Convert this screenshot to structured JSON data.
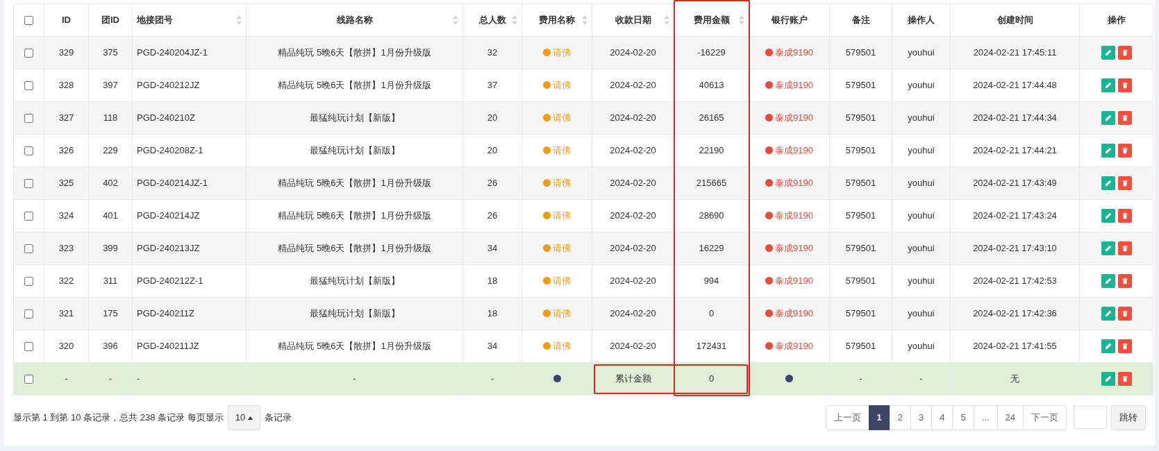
{
  "table": {
    "columns": [
      {
        "kind": "checkbox",
        "checked": false,
        "sortable": false,
        "outlined": false
      },
      {
        "label": "ID",
        "sortable": false,
        "outlined": false
      },
      {
        "label": "团ID",
        "sortable": false,
        "outlined": false
      },
      {
        "label": "地接团号",
        "sortable": true,
        "outlined": false
      },
      {
        "label": "线路名称",
        "sortable": true,
        "outlined": false
      },
      {
        "label": "总人数",
        "sortable": true,
        "outlined": false
      },
      {
        "label": "费用名称",
        "sortable": true,
        "outlined": false
      },
      {
        "label": "收款日期",
        "sortable": true,
        "outlined": false
      },
      {
        "label": "费用金额",
        "sortable": true,
        "outlined": true
      },
      {
        "label": "银行账户",
        "sortable": false,
        "outlined": false
      },
      {
        "label": "备注",
        "sortable": false,
        "outlined": false
      },
      {
        "label": "操作人",
        "sortable": false,
        "outlined": false
      },
      {
        "label": "创建时间",
        "sortable": false,
        "outlined": false
      },
      {
        "label": "操作",
        "sortable": false,
        "outlined": false
      }
    ],
    "rows": [
      {
        "checked": false,
        "id": "329",
        "group_id": "375",
        "code": "PGD-240204JZ-1",
        "route": "精品纯玩 5晚6天【散拼】1月份升级版",
        "people": "32",
        "fee": {
          "text": "请佛",
          "color": "#f39c12"
        },
        "date": "2024-02-20",
        "amount": "-16229",
        "bank": {
          "text": "泰成9190",
          "color": "#e74c3c"
        },
        "note": "579501",
        "operator": "youhui",
        "created": "2024-02-21 17:45:11"
      },
      {
        "checked": false,
        "id": "328",
        "group_id": "397",
        "code": "PGD-240212JZ",
        "route": "精品纯玩 5晚6天【散拼】1月份升级版",
        "people": "37",
        "fee": {
          "text": "请佛",
          "color": "#f39c12"
        },
        "date": "2024-02-20",
        "amount": "40613",
        "bank": {
          "text": "泰成9190",
          "color": "#e74c3c"
        },
        "note": "579501",
        "operator": "youhui",
        "created": "2024-02-21 17:44:48"
      },
      {
        "checked": false,
        "id": "327",
        "group_id": "118",
        "code": "PGD-240210Z",
        "route": "最猛纯玩计划【新版】",
        "people": "20",
        "fee": {
          "text": "请佛",
          "color": "#f39c12"
        },
        "date": "2024-02-20",
        "amount": "26165",
        "bank": {
          "text": "泰成9190",
          "color": "#e74c3c"
        },
        "note": "579501",
        "operator": "youhui",
        "created": "2024-02-21 17:44:34"
      },
      {
        "checked": false,
        "id": "326",
        "group_id": "229",
        "code": "PGD-240208Z-1",
        "route": "最猛纯玩计划【新版】",
        "people": "20",
        "fee": {
          "text": "请佛",
          "color": "#f39c12"
        },
        "date": "2024-02-20",
        "amount": "22190",
        "bank": {
          "text": "泰成9190",
          "color": "#e74c3c"
        },
        "note": "579501",
        "operator": "youhui",
        "created": "2024-02-21 17:44:21"
      },
      {
        "checked": false,
        "id": "325",
        "group_id": "402",
        "code": "PGD-240214JZ-1",
        "route": "精品纯玩 5晚6天【散拼】1月份升级版",
        "people": "26",
        "fee": {
          "text": "请佛",
          "color": "#f39c12"
        },
        "date": "2024-02-20",
        "amount": "215665",
        "bank": {
          "text": "泰成9190",
          "color": "#e74c3c"
        },
        "note": "579501",
        "operator": "youhui",
        "created": "2024-02-21 17:43:49"
      },
      {
        "checked": false,
        "id": "324",
        "group_id": "401",
        "code": "PGD-240214JZ",
        "route": "精品纯玩 5晚6天【散拼】1月份升级版",
        "people": "26",
        "fee": {
          "text": "请佛",
          "color": "#f39c12"
        },
        "date": "2024-02-20",
        "amount": "28690",
        "bank": {
          "text": "泰成9190",
          "color": "#e74c3c"
        },
        "note": "579501",
        "operator": "youhui",
        "created": "2024-02-21 17:43:24"
      },
      {
        "checked": false,
        "id": "323",
        "group_id": "399",
        "code": "PGD-240213JZ",
        "route": "精品纯玩 5晚6天【散拼】1月份升级版",
        "people": "34",
        "fee": {
          "text": "请佛",
          "color": "#f39c12"
        },
        "date": "2024-02-20",
        "amount": "16229",
        "bank": {
          "text": "泰成9190",
          "color": "#e74c3c"
        },
        "note": "579501",
        "operator": "youhui",
        "created": "2024-02-21 17:43:10"
      },
      {
        "checked": false,
        "id": "322",
        "group_id": "311",
        "code": "PGD-240212Z-1",
        "route": "最猛纯玩计划【新版】",
        "people": "18",
        "fee": {
          "text": "请佛",
          "color": "#f39c12"
        },
        "date": "2024-02-20",
        "amount": "994",
        "bank": {
          "text": "泰成9190",
          "color": "#e74c3c"
        },
        "note": "579501",
        "operator": "youhui",
        "created": "2024-02-21 17:42:53"
      },
      {
        "checked": false,
        "id": "321",
        "group_id": "175",
        "code": "PGD-240211Z",
        "route": "最猛纯玩计划【新版】",
        "people": "18",
        "fee": {
          "text": "请佛",
          "color": "#f39c12"
        },
        "date": "2024-02-20",
        "amount": "0",
        "bank": {
          "text": "泰成9190",
          "color": "#e74c3c"
        },
        "note": "579501",
        "operator": "youhui",
        "created": "2024-02-21 17:42:36"
      },
      {
        "checked": false,
        "id": "320",
        "group_id": "396",
        "code": "PGD-240211JZ",
        "route": "精品纯玩 5晚6天【散拼】1月份升级版",
        "people": "34",
        "fee": {
          "text": "请佛",
          "color": "#f39c12"
        },
        "date": "2024-02-20",
        "amount": "172431",
        "bank": {
          "text": "泰成9190",
          "color": "#e74c3c"
        },
        "note": "579501",
        "operator": "youhui",
        "created": "2024-02-21 17:41:55"
      }
    ],
    "summary": {
      "cells": [
        {
          "kind": "checkbox",
          "checked": false,
          "outlined": false
        },
        {
          "kind": "text",
          "text": "-",
          "outlined": false
        },
        {
          "kind": "text",
          "text": "-",
          "outlined": false
        },
        {
          "kind": "text",
          "text": "-",
          "outlined": false
        },
        {
          "kind": "text",
          "text": "-",
          "outlined": false
        },
        {
          "kind": "text",
          "text": "-",
          "outlined": false
        },
        {
          "kind": "dot",
          "color": "#3d4566",
          "outlined": false
        },
        {
          "kind": "text",
          "text": "累计金额",
          "outlined": true
        },
        {
          "kind": "text",
          "text": "0",
          "outlined": true
        },
        {
          "kind": "dot",
          "color": "#3d4566",
          "outlined": false
        },
        {
          "kind": "text",
          "text": "-",
          "outlined": false
        },
        {
          "kind": "text",
          "text": "-",
          "outlined": false
        },
        {
          "kind": "text",
          "text": "无",
          "outlined": false
        },
        {
          "kind": "actions",
          "outlined": false
        }
      ]
    }
  },
  "footer": {
    "info": "显示第 1 到第 10 条记录，总共 238 条记录 每页显示",
    "page_size": "10",
    "info_suffix": "条记录"
  },
  "pagination": {
    "pages": [
      {
        "label": "上一页",
        "selected": false
      },
      {
        "label": "1",
        "selected": true
      },
      {
        "label": "2",
        "selected": false
      },
      {
        "label": "3",
        "selected": false
      },
      {
        "label": "4",
        "selected": false
      },
      {
        "label": "5",
        "selected": false
      },
      {
        "label": "...",
        "selected": false
      },
      {
        "label": "24",
        "selected": false
      },
      {
        "label": "下一页",
        "selected": false
      }
    ],
    "jump_button": "跳转"
  }
}
